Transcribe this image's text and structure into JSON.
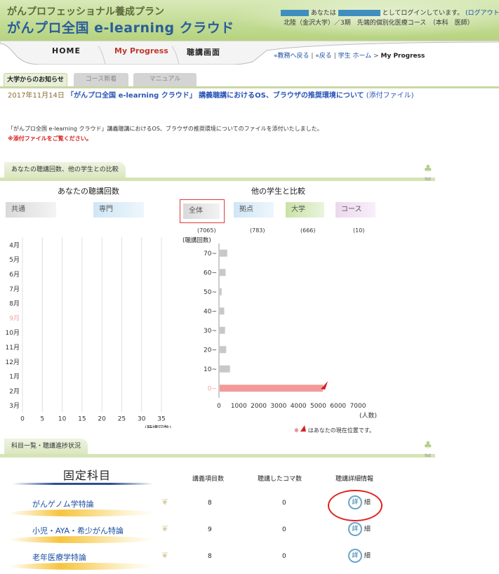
{
  "header": {
    "subtitle": "がんプロフェッショナル養成プラン",
    "title": "がんプロ全国 e-learning クラウド",
    "login_prefix": "あなたは",
    "login_suffix": "としてログインしています。",
    "logout_label": "(ログアウト)",
    "user_course": "北陸（金沢大学）／3期　先端的個別化医療コース　（本科　医師）"
  },
  "nav": {
    "home": "HOME",
    "my_progress": "My Progress",
    "lecture": "聴講画面",
    "breadcrumb": {
      "back_office": "«教務へ戻る",
      "back": "«戻る",
      "student_home": "学生 ホーム",
      "arrow": ">",
      "current": "My Progress"
    }
  },
  "notice_tabs": {
    "university": "大学からのお知らせ",
    "course_new": "コース新着",
    "manual": "マニュアル"
  },
  "notice": {
    "date": "2017年11月14日",
    "title": "「がんプロ全国 e-learning クラウド」 講義聴講におけるOS、ブラウザの推奨環境について",
    "attachment": "(添付ファイル)",
    "body": "「がんプロ全国 e-learning クラウド」講義聴講におけるOS、ブラウザの推奨環境についてのファイルを添付いたしました。",
    "warning": "※添付ファイルをご覧ください。"
  },
  "section_compare": {
    "title": "あなたの聴講回数、他の学生との比較",
    "list_label": "list"
  },
  "my_views": {
    "title": "あなたの聴講回数",
    "toggles": [
      "共通",
      "専門"
    ],
    "months": [
      "4月",
      "5月",
      "6月",
      "7月",
      "8月",
      "9月",
      "10月",
      "11月",
      "12月",
      "1月",
      "2月",
      "3月"
    ],
    "current_month": "9月",
    "x_ticks": [
      "0",
      "5",
      "10",
      "15",
      "20",
      "25",
      "30",
      "35"
    ],
    "x_unit": "(聴講回数)"
  },
  "compare": {
    "title": "他の学生と比較",
    "toggles": [
      "全体",
      "拠点",
      "大学",
      "コース"
    ],
    "counts": [
      "(7065)",
      "(783)",
      "(666)",
      "(10)"
    ],
    "y_label": "(聴講回数)",
    "x_unit": "(人数)",
    "legend_note": "はあなたの現在位置です。",
    "legend_prefix": "※"
  },
  "chart_data": [
    {
      "type": "bar",
      "title": "あなたの聴講回数",
      "orientation": "horizontal",
      "categories": [
        "4月",
        "5月",
        "6月",
        "7月",
        "8月",
        "9月",
        "10月",
        "11月",
        "12月",
        "1月",
        "2月",
        "3月"
      ],
      "values": [
        0,
        0,
        0,
        0,
        0,
        0,
        0,
        0,
        0,
        0,
        0,
        0
      ],
      "xlabel": "(聴講回数)",
      "xlim": [
        0,
        35
      ],
      "grid": true
    },
    {
      "type": "bar",
      "title": "他の学生と比較",
      "orientation": "horizontal",
      "categories": [
        "70~",
        "60~",
        "50~",
        "40~",
        "30~",
        "20~",
        "10~",
        "0~"
      ],
      "values": [
        380,
        300,
        100,
        230,
        270,
        330,
        520,
        5200
      ],
      "highlight_category": "0~",
      "xlabel": "(人数)",
      "ylabel": "(聴講回数)",
      "xlim": [
        0,
        7000
      ],
      "x_ticks": [
        0,
        1000,
        2000,
        3000,
        4000,
        5000,
        6000,
        7000
      ],
      "colors": {
        "bar": "#c8c8c8",
        "highlight": "#f29a9a",
        "marker": "#d62020"
      }
    }
  ],
  "section_subjects": {
    "title": "科目一覧・聴講進捗状況",
    "list_label": "list"
  },
  "subjects": {
    "group_title": "固定科目",
    "headers": {
      "items": "講義項目数",
      "watched": "聴講したコマ数",
      "detail": "聴講詳細情報"
    },
    "detail_icon": "詳",
    "detail_label": "細",
    "rows": [
      {
        "name": "がんゲノム学特論",
        "items": "8",
        "watched": "0"
      },
      {
        "name": "小児・AYA・希少がん特論",
        "items": "9",
        "watched": "0"
      },
      {
        "name": "老年医療学特論",
        "items": "8",
        "watched": "0"
      }
    ]
  }
}
